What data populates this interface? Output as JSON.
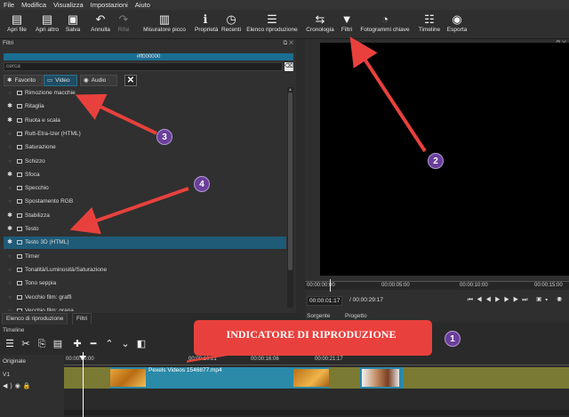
{
  "menubar": [
    "File",
    "Modifica",
    "Visualizza",
    "Impostazioni",
    "Aiuto"
  ],
  "toolbar": {
    "items": [
      {
        "label": "Apri file",
        "icon": "folder-open-icon",
        "glyph": "▤"
      },
      {
        "label": "Apri altro",
        "icon": "folder-open-more-icon",
        "glyph": "▤"
      },
      {
        "label": "Salva",
        "icon": "save-icon",
        "glyph": "▣"
      },
      {
        "label": "Annulla",
        "icon": "undo-icon",
        "glyph": "↶"
      },
      {
        "label": "Rifai",
        "icon": "redo-icon",
        "glyph": "↷"
      },
      {
        "label": "Misuratore picco",
        "icon": "peak-meter-icon",
        "glyph": "▥"
      },
      {
        "label": "Proprietà",
        "icon": "info-icon",
        "glyph": "ℹ"
      },
      {
        "label": "Recenti",
        "icon": "clock-icon",
        "glyph": "◷"
      },
      {
        "label": "Elenco riproduzione",
        "icon": "playlist-icon",
        "glyph": "☰"
      },
      {
        "label": "Cronologia",
        "icon": "history-icon",
        "glyph": "⇆"
      },
      {
        "label": "Filtri",
        "icon": "filter-icon",
        "glyph": "▼"
      },
      {
        "label": "Fotogrammi chiave",
        "icon": "stopwatch-icon",
        "glyph": "◔"
      },
      {
        "label": "Timeline",
        "icon": "timeline-icon",
        "glyph": "☷"
      },
      {
        "label": "Esporta",
        "icon": "export-disc-icon",
        "glyph": "◉"
      }
    ]
  },
  "filters_panel": {
    "title": "Filtri",
    "color_value": "#ff000000",
    "search_placeholder": "cerca",
    "tabs": {
      "favorites": "Favorito",
      "video": "Video",
      "audio": "Audio"
    },
    "items": [
      {
        "label": "Rimozione macchie",
        "favorite": false
      },
      {
        "label": "Ritaglia",
        "favorite": true
      },
      {
        "label": "Ruota e scala",
        "favorite": true
      },
      {
        "label": "Rutt-Etra-Izer (HTML)",
        "favorite": false
      },
      {
        "label": "Saturazione",
        "favorite": false
      },
      {
        "label": "Schizzo",
        "favorite": false
      },
      {
        "label": "Sfoca",
        "favorite": true
      },
      {
        "label": "Specchio",
        "favorite": false
      },
      {
        "label": "Spostamento RGB",
        "favorite": false
      },
      {
        "label": "Stabilizza",
        "favorite": true
      },
      {
        "label": "Testo",
        "favorite": true
      },
      {
        "label": "Testo 3D (HTML)",
        "favorite": true,
        "selected": true
      },
      {
        "label": "Timer",
        "favorite": false
      },
      {
        "label": "Tonalità/Luminosità/Saturazione",
        "favorite": false
      },
      {
        "label": "Tono seppia",
        "favorite": false
      },
      {
        "label": "Vecchio film: graffi",
        "favorite": false
      },
      {
        "label": "Vecchio film: grana",
        "favorite": false
      }
    ]
  },
  "bottom_tabs": [
    "Elenco di riproduzione",
    "Filtri"
  ],
  "player": {
    "ruler_ticks": [
      "00:00:00:00",
      "00:00:05:00",
      "00:00:10:00",
      "00:00:15:00"
    ],
    "current_time": "00:00:01:17",
    "total_time": "/ 00:00:29:17",
    "source_tabs": [
      "Sorgente",
      "Progetto"
    ]
  },
  "timeline": {
    "title": "Timeline",
    "master_label": "Originale",
    "track_label": "V1",
    "ruler_ticks": [
      "00:00:00:00",
      "00:00:10:21",
      "00:00:16:06",
      "00:00:21:17"
    ],
    "clip_label": "Pexels Videos 1546877.mp4"
  },
  "annotations": {
    "callout_text": "INDICATORE DI RIPRODUZIONE",
    "badges": [
      "1",
      "2",
      "3",
      "4"
    ],
    "arrow_color": "#e8413d",
    "badge_color": "#6a3f9a"
  }
}
